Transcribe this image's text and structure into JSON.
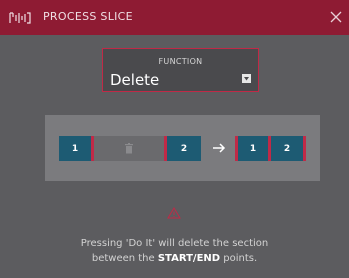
{
  "window": {
    "title": "PROCESS SLICE",
    "accent_color": "#8e1b33",
    "logo_icon": "mpc-logo-icon",
    "close_icon": "close-icon"
  },
  "function_select": {
    "label": "FUNCTION",
    "value": "Delete",
    "icon": "dropdown-icon"
  },
  "diagram": {
    "before": [
      {
        "label": "1"
      },
      {
        "label": "",
        "icon": "trash-icon"
      },
      {
        "label": "2"
      }
    ],
    "arrow_icon": "arrow-right-icon",
    "after": [
      {
        "label": "1"
      },
      {
        "label": "2"
      }
    ]
  },
  "message": {
    "icon": "warning-icon",
    "line1": "Pressing 'Do It' will delete the section",
    "line2_prefix": "between the ",
    "line2_bold": "START/END",
    "line2_suffix": " points."
  }
}
